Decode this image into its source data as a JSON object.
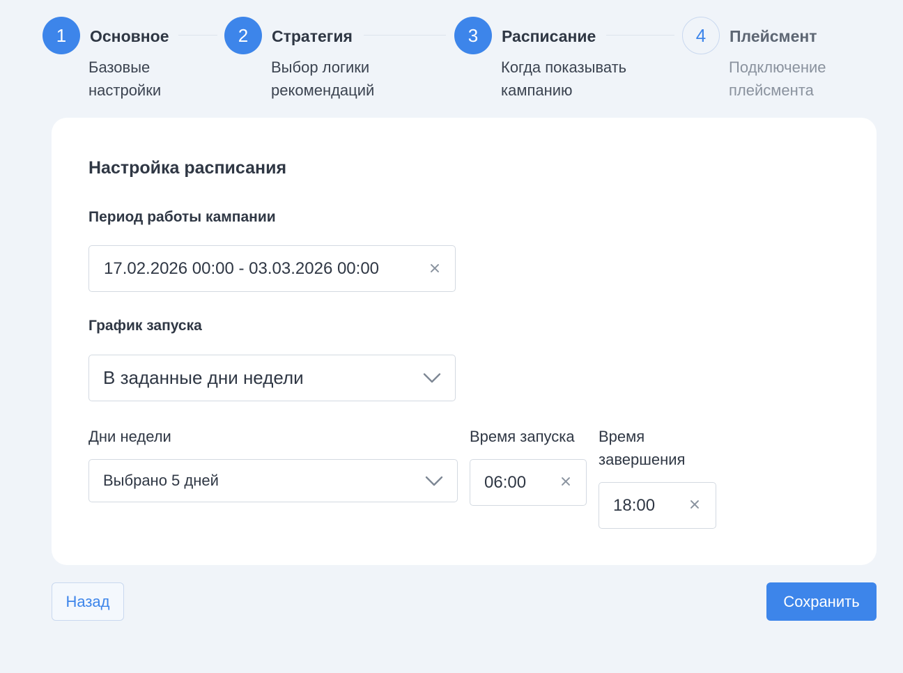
{
  "stepper": {
    "steps": [
      {
        "number": "1",
        "title": "Основное",
        "desc_line1": "Базовые",
        "desc_line2": "настройки"
      },
      {
        "number": "2",
        "title": "Стратегия",
        "desc_line1": "Выбор логики",
        "desc_line2": "рекомендаций"
      },
      {
        "number": "3",
        "title": "Расписание",
        "desc_line1": "Когда показывать",
        "desc_line2": "кампанию"
      },
      {
        "number": "4",
        "title": "Плейсмент",
        "desc_line1": "Подключение",
        "desc_line2": "плейсмента"
      }
    ],
    "active_step_count": 3
  },
  "card": {
    "title": "Настройка расписания",
    "period": {
      "label": "Период работы кампании",
      "value": "17.02.2026 00:00 - 03.03.2026 00:00"
    },
    "schedule": {
      "label": "График запуска",
      "value": "В заданные дни недели"
    },
    "weekdays": {
      "label": "Дни недели",
      "value": "Выбрано 5 дней"
    },
    "start_time": {
      "label": "Время запуска",
      "value": "06:00"
    },
    "end_time": {
      "label_line1": "Время",
      "label_line2": "завершения",
      "value": "18:00"
    }
  },
  "actions": {
    "back_label": "Назад",
    "save_label": "Сохранить"
  },
  "colors": {
    "accent": "#3d85ea",
    "background": "#f0f4f9",
    "card": "#ffffff",
    "text": "#2f3744",
    "border": "#d3d9e1"
  },
  "icons": {
    "clear": "close-icon",
    "dropdown": "chevron-down-icon"
  }
}
